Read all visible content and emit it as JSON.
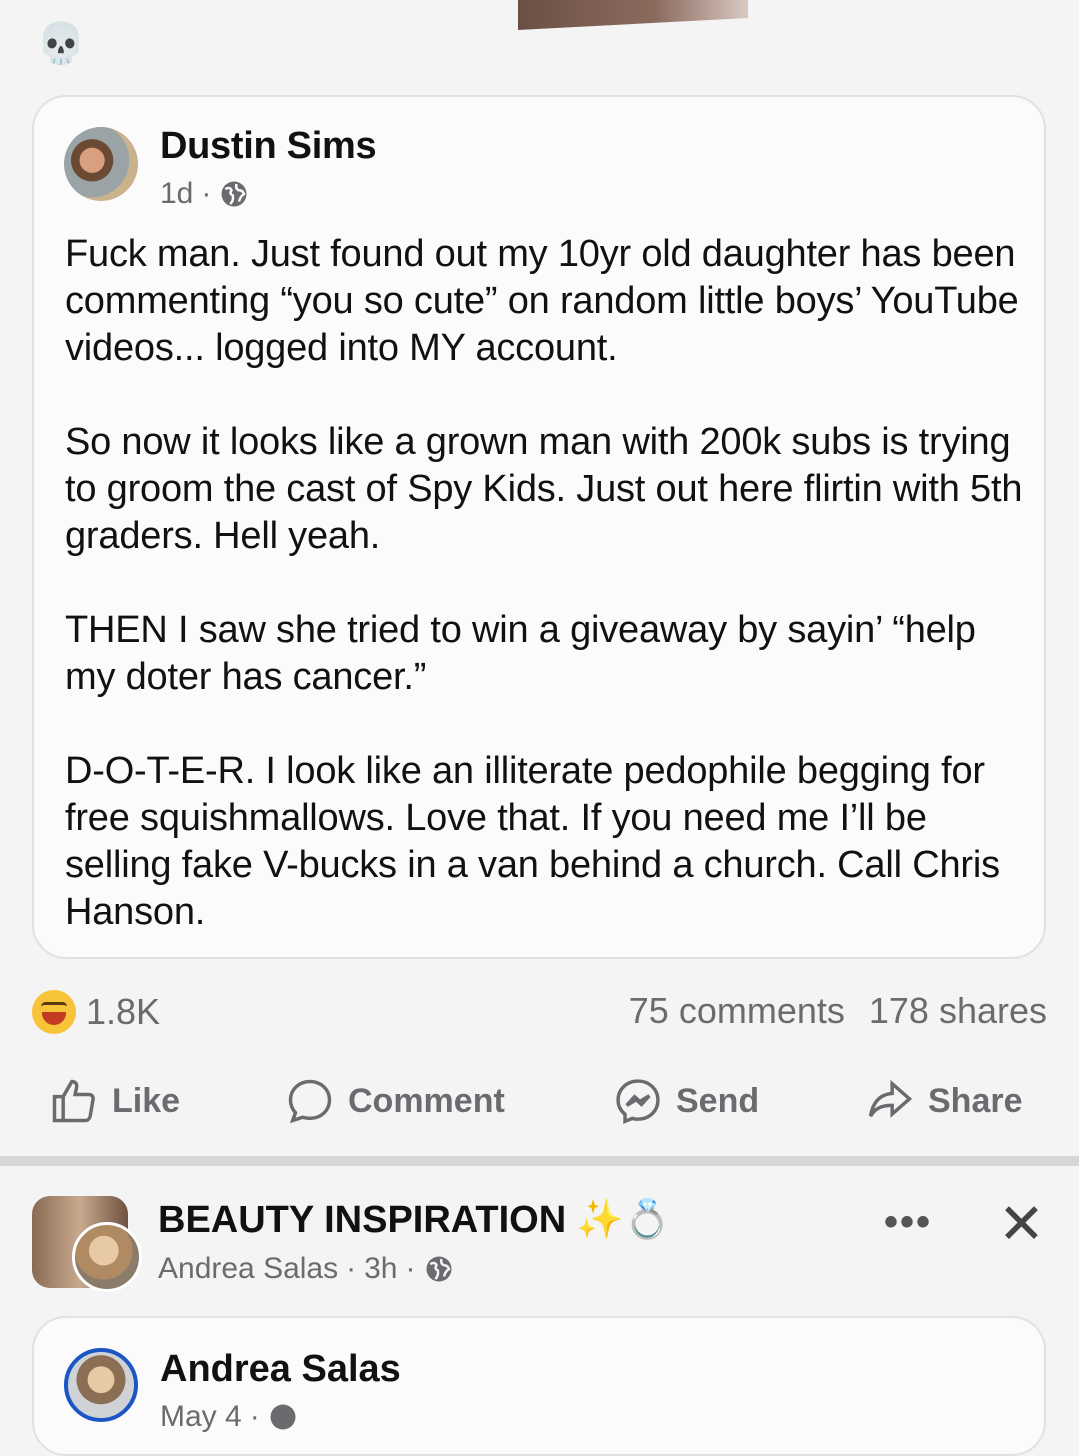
{
  "top_reaction_icon": "skull-icon",
  "post": {
    "author": "Dustin Sims",
    "time": "1d",
    "separator": "·",
    "paragraphs": [
      "Fuck man. Just found out my 10yr old daughter has been commenting “you so cute” on random little boys’ YouTube videos... logged into MY account.",
      "So now it looks like a grown man with 200k subs is trying to groom the cast of Spy Kids. Just out here flirtin with 5th graders. Hell yeah.",
      "THEN I saw she tried to win a giveaway by sayin’ “help my doter has cancer.”",
      "D-O-T-E-R. I look like an illiterate pedophile begging for free squishmallows. Love that. If you need me I’ll be selling fake V-bucks in a van behind a church. Call Chris Hanson."
    ],
    "reaction_count": "1.8K",
    "comments": "75 comments",
    "shares": "178 shares"
  },
  "actions": {
    "like": "Like",
    "comment": "Comment",
    "send": "Send",
    "share": "Share"
  },
  "next_post": {
    "group": "BEAUTY INSPIRATION",
    "group_emojis": "✨💍",
    "poster": "Andrea Salas",
    "time": "3h",
    "separator": "·",
    "more": "•••",
    "close": "✕",
    "inner_author": "Andrea Salas",
    "inner_time": "May 4"
  },
  "colors": {
    "background": "#f4f4f5",
    "secondary_text": "#6b6b6f",
    "card_border": "#e1e1e3"
  }
}
